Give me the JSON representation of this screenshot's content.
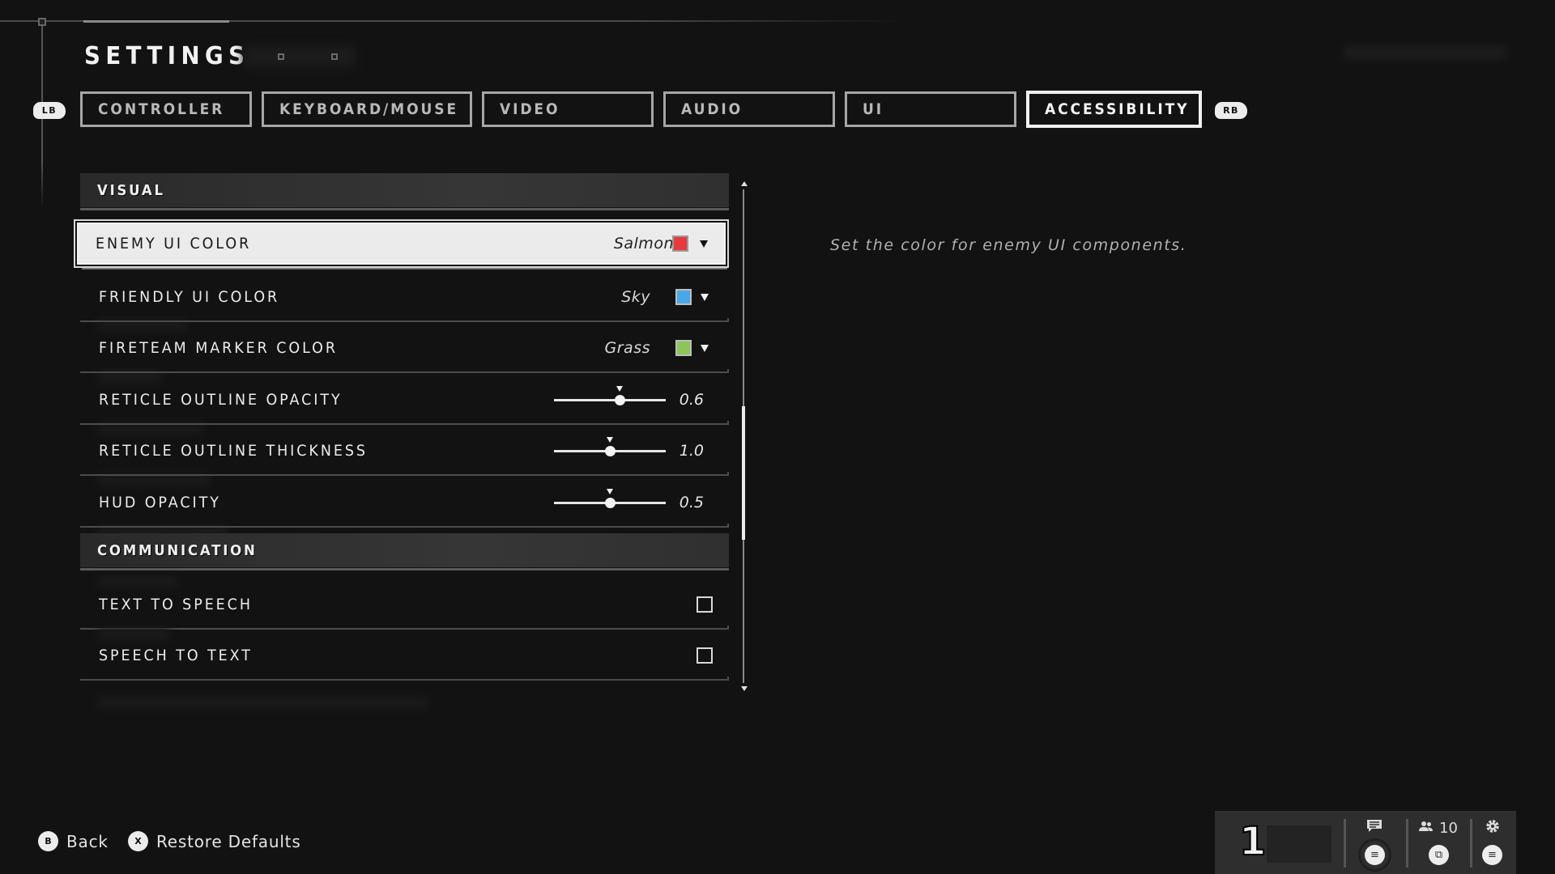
{
  "header": {
    "title": "SETTINGS"
  },
  "tabs": [
    {
      "label": "CONTROLLER",
      "active": false
    },
    {
      "label": "KEYBOARD/MOUSE",
      "active": false
    },
    {
      "label": "VIDEO",
      "active": false
    },
    {
      "label": "AUDIO",
      "active": false
    },
    {
      "label": "UI",
      "active": false
    },
    {
      "label": "ACCESSIBILITY",
      "active": true
    }
  ],
  "bumpers": {
    "left": "LB",
    "right": "RB"
  },
  "sections": {
    "visual": {
      "title": "VISUAL",
      "items": [
        {
          "label": "ENEMY UI COLOR",
          "type": "dropdown",
          "value": "Salmon",
          "swatch": "#e8393c",
          "focused": true
        },
        {
          "label": "FRIENDLY UI COLOR",
          "type": "dropdown",
          "value": "Sky",
          "swatch": "#4aa8e8"
        },
        {
          "label": "FIRETEAM MARKER COLOR",
          "type": "dropdown",
          "value": "Grass",
          "swatch": "#8cc55a"
        },
        {
          "label": "RETICLE OUTLINE OPACITY",
          "type": "slider",
          "value": "0.6",
          "fill_fraction": 0.59,
          "default_fraction": 0.59
        },
        {
          "label": "RETICLE OUTLINE THICKNESS",
          "type": "slider",
          "value": "1.0",
          "fill_fraction": 0.5,
          "default_fraction": 0.5
        },
        {
          "label": "HUD OPACITY",
          "type": "slider",
          "value": "0.5",
          "fill_fraction": 0.5,
          "default_fraction": 0.5
        }
      ]
    },
    "communication": {
      "title": "COMMUNICATION",
      "items": [
        {
          "label": "TEXT TO SPEECH",
          "type": "checkbox",
          "checked": false
        },
        {
          "label": "SPEECH TO TEXT",
          "type": "checkbox",
          "checked": false
        }
      ]
    }
  },
  "scrollbar": {
    "thumb_start_fraction": 0.44,
    "thumb_size_fraction": 0.27
  },
  "description": "Set the color for enemy UI components.",
  "footer": {
    "back": {
      "button": "B",
      "label": "Back"
    },
    "restore": {
      "button": "X",
      "label": "Restore Defaults"
    }
  },
  "status_panel": {
    "player_number": "1",
    "chat_icon": "chat-bubble-icon",
    "party_icon": "people-icon",
    "party_count": "10",
    "settings_icon": "gear-icon",
    "menu_glyph": "≡",
    "view_glyph": "⧉"
  },
  "colors": {
    "background": "#121212",
    "focused_row": "#ebebeb",
    "section_header": "#333333",
    "tab_border": "#a6a6a6",
    "tab_active_border": "#f0f0f0"
  }
}
